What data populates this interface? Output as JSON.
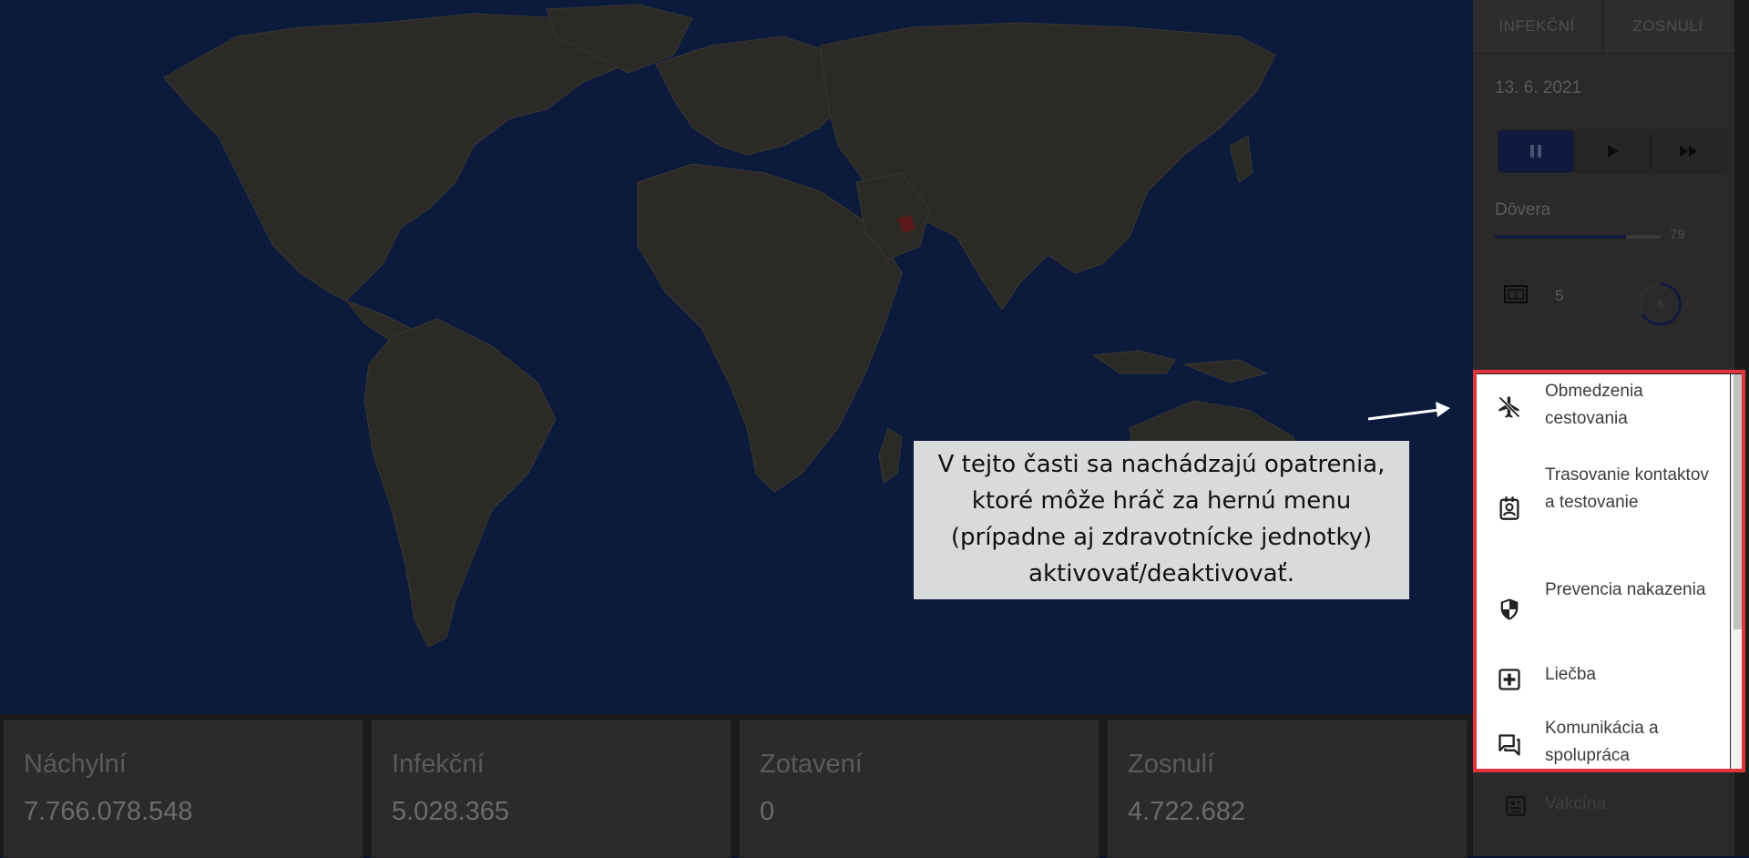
{
  "tabs": [
    "INFEKČNÍ",
    "ZOSNULÍ"
  ],
  "date": "13. 6. 2021",
  "trust": {
    "label": "Dôvera",
    "value": "79",
    "fraction": 0.79
  },
  "money": {
    "icon": "money-icon",
    "value": "5"
  },
  "ring_value": "6",
  "speed_controls": [
    "pause-icon",
    "play-icon",
    "fast-forward-icon"
  ],
  "measures": [
    {
      "icon": "airplane-off-icon",
      "label": "Obmedzenia cestovania"
    },
    {
      "icon": "contact-badge-icon",
      "label": "Trasovanie kontaktov a testovanie"
    },
    {
      "icon": "shield-icon",
      "label": "Prevencia nakazenia"
    },
    {
      "icon": "medical-plus-icon",
      "label": "Liečba"
    },
    {
      "icon": "chat-icon",
      "label": "Komunikácia a spolupráca"
    }
  ],
  "below_item": {
    "icon": "vaccine-icon",
    "label": "Vakcína"
  },
  "stats": [
    {
      "label": "Náchylní",
      "value": "7.766.078.548"
    },
    {
      "label": "Infekční",
      "value": "5.028.365"
    },
    {
      "label": "Zotavení",
      "value": "0"
    },
    {
      "label": "Zosnulí",
      "value": "4.722.682"
    }
  ],
  "annotation": "V tejto časti sa nachádzajú opatrenia, ktoré môže hráč za hernú menu (prípadne aj zdravotnícke jednotky) aktivovať/deaktivovať.",
  "colors": {
    "highlight": "#e0353b",
    "accent": "#0f1a3e",
    "map_background": "#0c1a3c",
    "land": "#2b2a26"
  }
}
